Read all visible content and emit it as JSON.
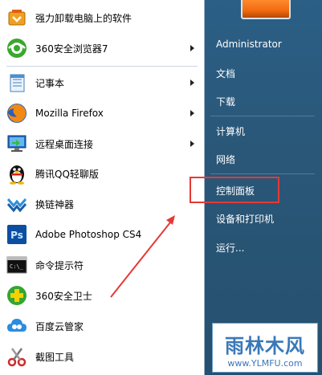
{
  "programs": [
    {
      "label": "强力卸载电脑上的软件",
      "icon": "uninstall-tool-icon",
      "has_submenu": false
    },
    {
      "label": "360安全浏览器7",
      "icon": "360-browser-icon",
      "has_submenu": true
    },
    {
      "label": "记事本",
      "icon": "notepad-icon",
      "has_submenu": true
    },
    {
      "label": "Mozilla Firefox",
      "icon": "firefox-icon",
      "has_submenu": true
    },
    {
      "label": "远程桌面连接",
      "icon": "remote-desktop-icon",
      "has_submenu": true
    },
    {
      "label": "腾讯QQ轻聊版",
      "icon": "qq-penguin-icon",
      "has_submenu": false
    },
    {
      "label": "换链神器",
      "icon": "link-swap-icon",
      "has_submenu": false
    },
    {
      "label": "Adobe Photoshop CS4",
      "icon": "photoshop-icon",
      "has_submenu": false
    },
    {
      "label": "命令提示符",
      "icon": "command-prompt-icon",
      "has_submenu": false
    },
    {
      "label": "360安全卫士",
      "icon": "360-safeguard-icon",
      "has_submenu": false
    },
    {
      "label": "百度云管家",
      "icon": "baidu-cloud-icon",
      "has_submenu": false
    },
    {
      "label": "截图工具",
      "icon": "snipping-tool-icon",
      "has_submenu": false
    }
  ],
  "right": {
    "user": "Administrator",
    "documents": "文档",
    "downloads": "下载",
    "computer": "计算机",
    "network": "网络",
    "control_panel": "控制面板",
    "devices": "设备和打印机",
    "run": "运行..."
  },
  "watermark": {
    "brand": "雨林木风",
    "url": "www.YLMFU.com"
  },
  "colors": {
    "highlight": "#e53935",
    "right_pane": "#2a5778"
  }
}
